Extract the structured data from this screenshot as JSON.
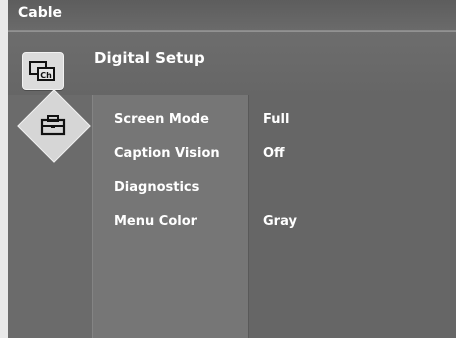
{
  "topbar": {
    "title": "Cable"
  },
  "header": {
    "title": "Digital Setup"
  },
  "sidebar": {
    "icons": [
      {
        "name": "channel-icon",
        "glyph": "Ch"
      },
      {
        "name": "setup-toolbox-icon"
      }
    ]
  },
  "menu": {
    "items": [
      {
        "label": "Screen Mode",
        "value": "Full"
      },
      {
        "label": "Caption Vision",
        "value": "Off"
      },
      {
        "label": "Diagnostics",
        "value": ""
      },
      {
        "label": "Menu Color",
        "value": "Gray"
      }
    ]
  }
}
